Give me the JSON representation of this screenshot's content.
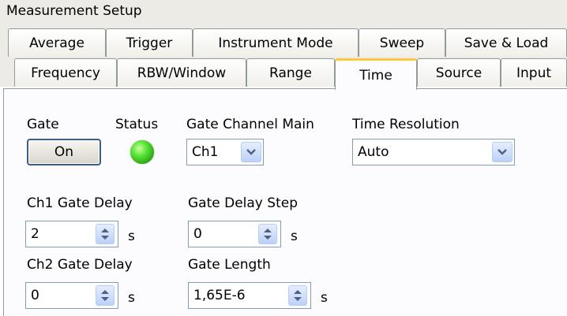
{
  "window": {
    "title": "Measurement Setup"
  },
  "tabs_row1": [
    "Average",
    "Trigger",
    "Instrument Mode",
    "Sweep",
    "Save & Load"
  ],
  "tabs_row2": [
    "Frequency",
    "RBW/Window",
    "Range",
    "Time",
    "Source",
    "Input"
  ],
  "active_tab": "Time",
  "gate": {
    "label": "Gate",
    "button_label": "On"
  },
  "status": {
    "label": "Status",
    "indicator_color": "#3cd61e"
  },
  "gate_channel_main": {
    "label": "Gate Channel Main",
    "value": "Ch1"
  },
  "time_resolution": {
    "label": "Time Resolution",
    "value": "Auto"
  },
  "ch1_gate_delay": {
    "label": "Ch1 Gate Delay",
    "value": "2",
    "unit": "s"
  },
  "gate_delay_step": {
    "label": "Gate Delay Step",
    "value": "0",
    "unit": "s"
  },
  "ch2_gate_delay": {
    "label": "Ch2 Gate Delay",
    "value": "0",
    "unit": "s"
  },
  "gate_length": {
    "label": "Gate Length",
    "value": "1,65E-6",
    "unit": "s"
  },
  "colors": {
    "accent_tab": "#ffc83c",
    "button_border": "#3d5d86",
    "field_border": "#7f9db9"
  }
}
